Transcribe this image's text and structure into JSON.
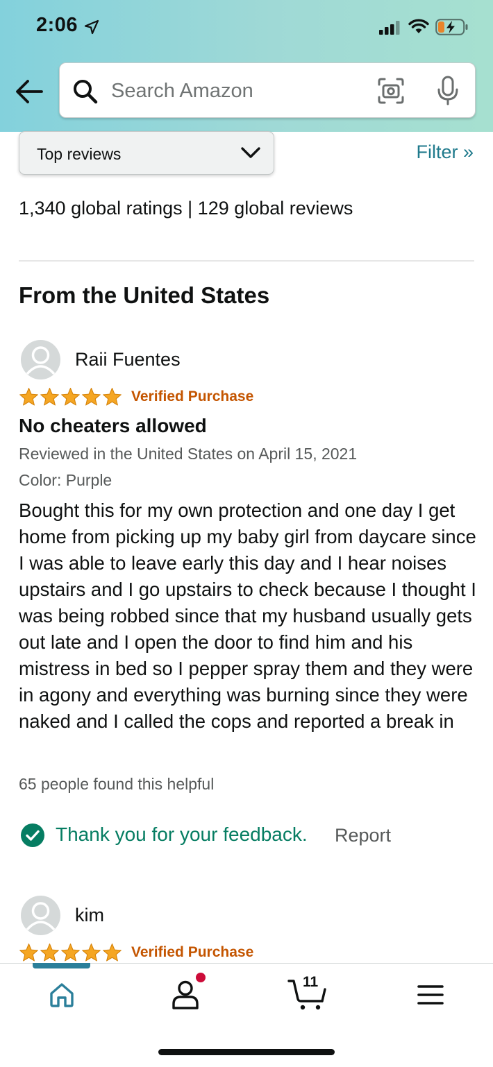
{
  "status_bar": {
    "time": "2:06"
  },
  "search": {
    "placeholder": "Search Amazon"
  },
  "sort": {
    "label": "Top reviews"
  },
  "filter": {
    "label": "Filter »"
  },
  "summary": {
    "text": "1,340 global ratings | 129 global reviews"
  },
  "section": {
    "heading": "From the United States"
  },
  "reviews": [
    {
      "name": "Raii Fuentes",
      "rating": 5,
      "verified": "Verified Purchase",
      "title": "No cheaters allowed",
      "date_line": "Reviewed in the United States on April 15, 2021",
      "variant": "Color: Purple",
      "body": "Bought this for my own protection and one day I get home from picking up my baby girl from daycare since I was able to leave early this day and I hear noises upstairs and I go upstairs to check because I thought I was being robbed since that my husband usually gets out late and I open the door to find him and his mistress in bed so I pepper spray them and they were in agony and everything was burning since they were naked and I called the cops and reported a break in",
      "helpful": "65 people found this helpful",
      "feedback": "Thank you for your feedback.",
      "report": "Report"
    },
    {
      "name": "kim",
      "rating": 5,
      "verified": "Verified Purchase"
    }
  ],
  "bottom_nav": {
    "items": [
      "home-icon",
      "account-icon",
      "cart-icon",
      "menu-icon"
    ],
    "cart_count": "11"
  },
  "colors": {
    "header_gradient": [
      "#83d1dc",
      "#a6e0d0"
    ],
    "star": "#f5a623",
    "verified": "#c45500",
    "link": "#1f7a8c",
    "success": "#067d62"
  }
}
